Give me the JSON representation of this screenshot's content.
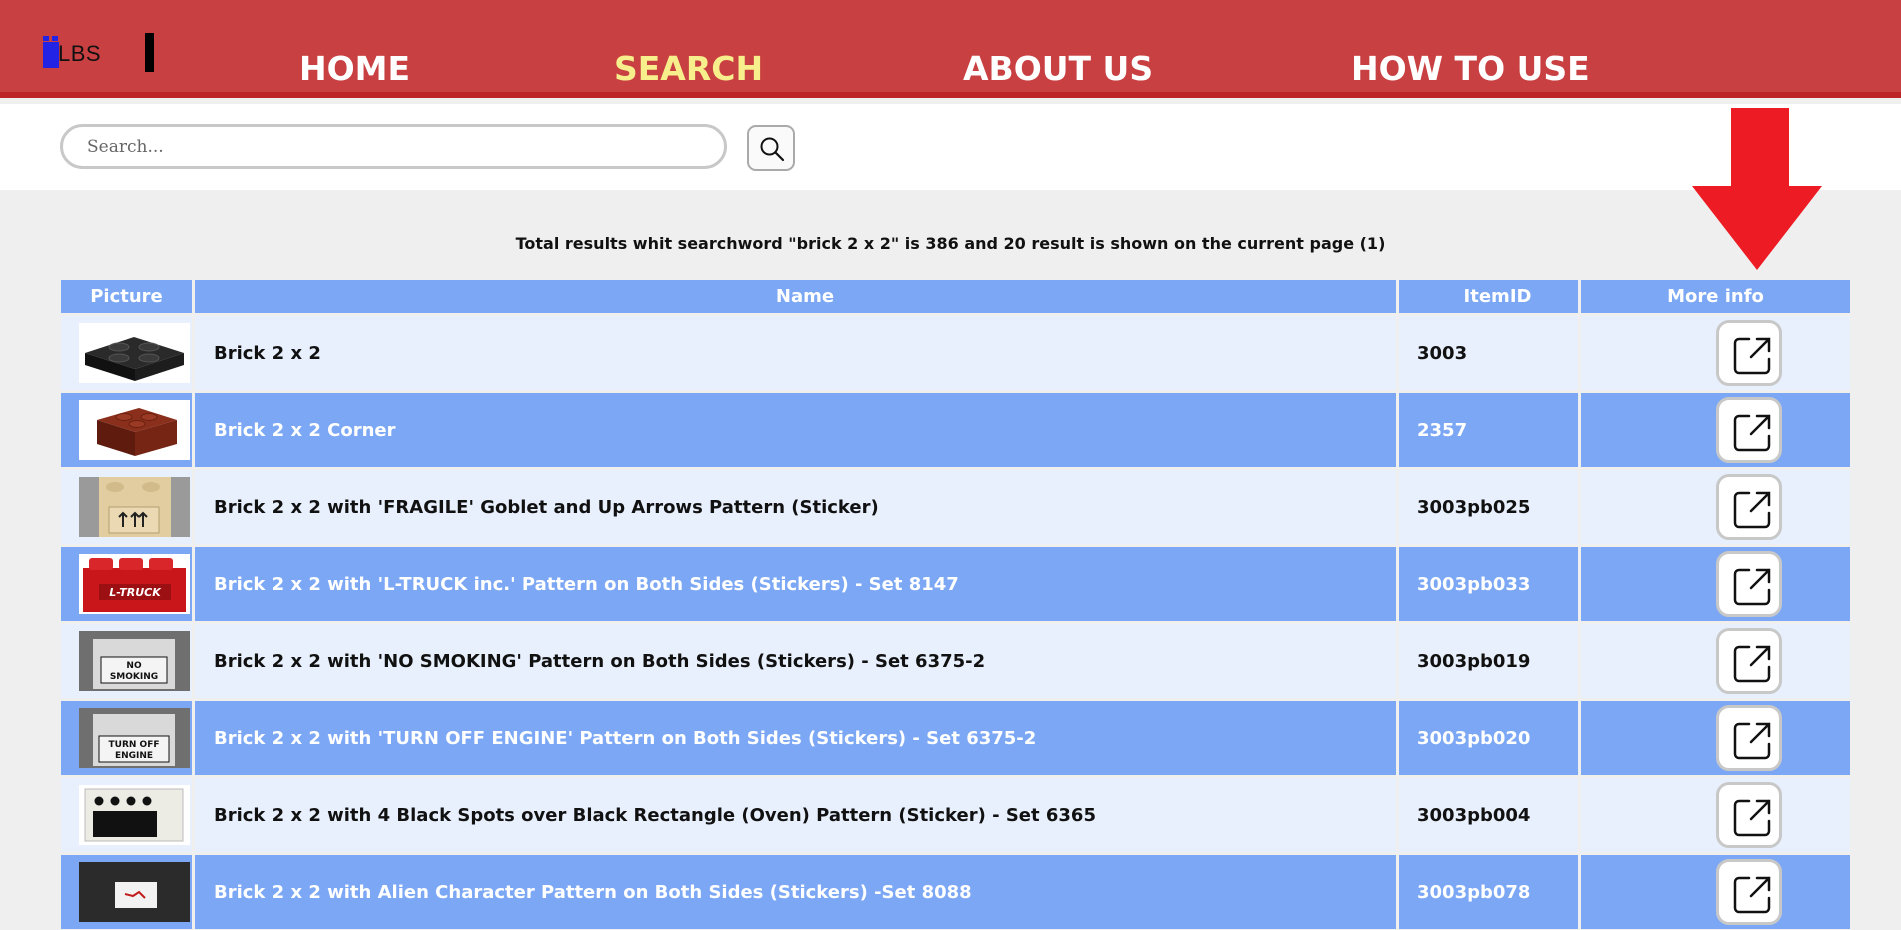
{
  "header": {
    "logo_text": "LBS",
    "nav": [
      {
        "label": "HOME",
        "active": false
      },
      {
        "label": "SEARCH",
        "active": true
      },
      {
        "label": "ABOUT US",
        "active": false
      },
      {
        "label": "HOW TO USE",
        "active": false
      }
    ],
    "colors": {
      "bar": "#c94042",
      "active_nav": "#f7ee8c"
    }
  },
  "search": {
    "placeholder": "Search...",
    "value": "",
    "button_icon": "search-icon"
  },
  "summary_text": "Total results whit searchword \"brick 2 x 2\" is 386 and 20 result is shown on the current page (1)",
  "table": {
    "headers": {
      "picture": "Picture",
      "name": "Name",
      "item_id": "ItemID",
      "more_info": "More info"
    },
    "rows": [
      {
        "name": "Brick 2 x 2",
        "item_id": "3003",
        "thumb": "black-brick"
      },
      {
        "name": "Brick 2 x 2 Corner",
        "item_id": "2357",
        "thumb": "red-brown-corner-brick"
      },
      {
        "name": "Brick 2 x 2 with 'FRAGILE' Goblet and Up Arrows Pattern (Sticker)",
        "item_id": "3003pb025",
        "thumb": "tan-fragile-brick"
      },
      {
        "name": "Brick 2 x 2 with 'L-TRUCK inc.' Pattern on Both Sides (Stickers) - Set 8147",
        "item_id": "3003pb033",
        "thumb": "red-ltruck-brick"
      },
      {
        "name": "Brick 2 x 2 with 'NO SMOKING' Pattern on Both Sides (Stickers) - Set 6375-2",
        "item_id": "3003pb019",
        "thumb": "white-nosmoking-brick"
      },
      {
        "name": "Brick 2 x 2 with 'TURN OFF ENGINE' Pattern on Both Sides (Stickers) - Set 6375-2",
        "item_id": "3003pb020",
        "thumb": "white-turnoff-brick"
      },
      {
        "name": "Brick 2 x 2 with 4 Black Spots over Black Rectangle (Oven) Pattern (Sticker) - Set 6365",
        "item_id": "3003pb004",
        "thumb": "white-oven-brick"
      },
      {
        "name": "Brick 2 x 2 with Alien Character Pattern on Both Sides (Stickers) -Set 8088",
        "item_id": "3003pb078",
        "thumb": "white-alien-brick"
      }
    ]
  },
  "thumb_labels": {
    "ltruck": "L-TRUCK",
    "nosmoking_1": "NO",
    "nosmoking_2": "SMOKING",
    "turnoff_1": "TURN OFF",
    "turnoff_2": "ENGINE"
  }
}
